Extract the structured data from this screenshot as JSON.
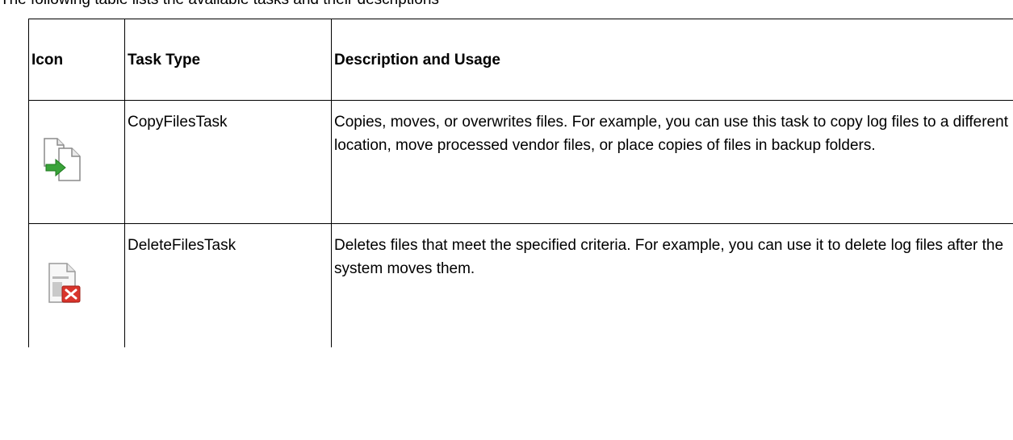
{
  "intro_text": "The following table lists the available tasks and their descriptions",
  "table": {
    "headers": {
      "icon": "Icon",
      "task_type": "Task Type",
      "description": "Description and Usage"
    },
    "rows": [
      {
        "icon": "copy-files-icon",
        "task_type": "CopyFilesTask",
        "description": "Copies, moves, or overwrites files. For example, you can use this task to copy log files to a different location, move processed vendor files, or place copies of files in backup folders."
      },
      {
        "icon": "delete-files-icon",
        "task_type": "DeleteFilesTask",
        "description": "Deletes files that meet the specified criteria. For example, you can use it to delete log files after the system moves them."
      }
    ]
  },
  "colors": {
    "border": "#000000",
    "copy_arrow": "#3aa33a",
    "delete_badge": "#d9342b"
  }
}
